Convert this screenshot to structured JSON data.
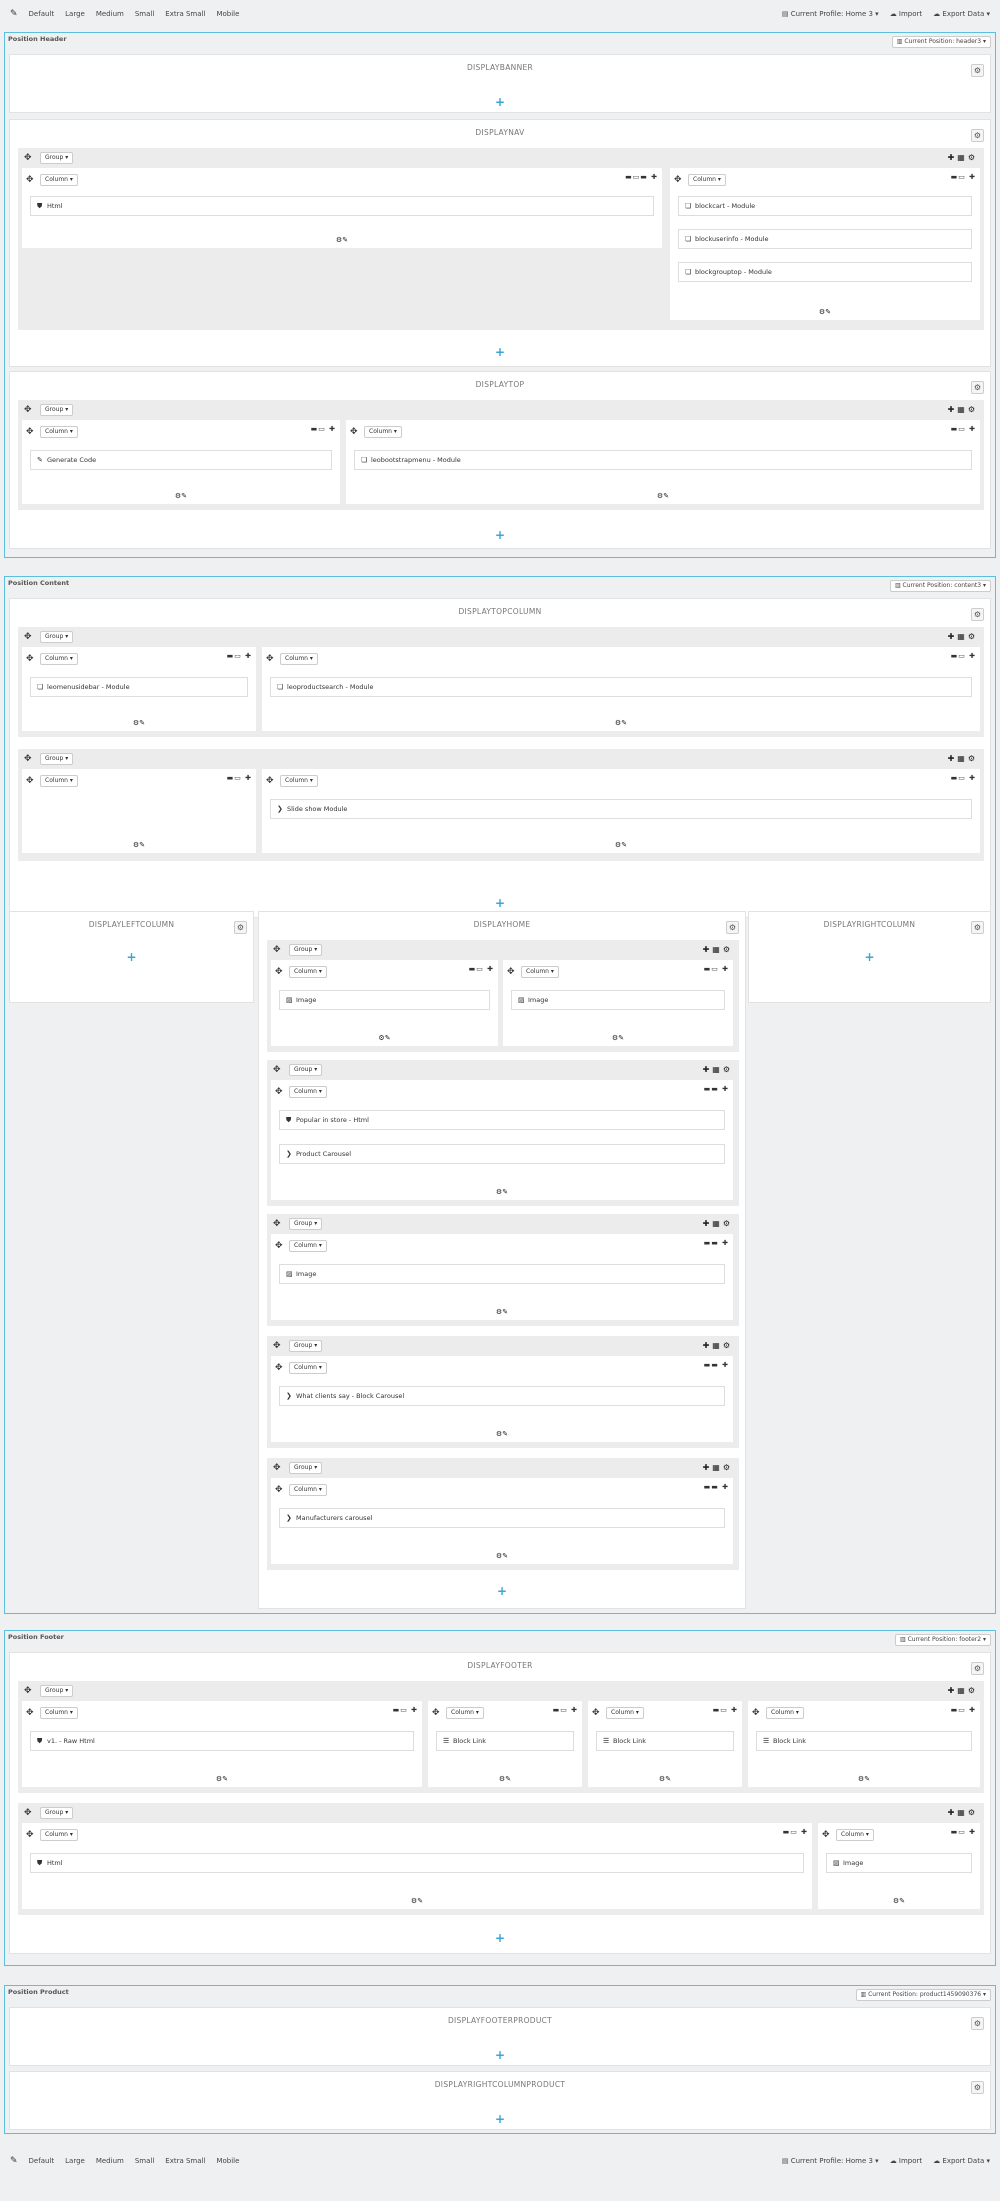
{
  "toolbar": {
    "items": [
      "Default",
      "Large",
      "Medium",
      "Small",
      "Extra Small",
      "Mobile"
    ],
    "profile": "Current Profile: Home 3",
    "import": "Import",
    "export": "Export Data"
  },
  "positions": [
    {
      "title": "Position Header",
      "current": "Current Position: header3"
    },
    {
      "title": "Position Content",
      "current": "Current Position: content3"
    },
    {
      "title": "Position Footer",
      "current": "Current Position: footer2"
    },
    {
      "title": "Position Product",
      "current": "Current Position: product1459090376"
    }
  ],
  "hooks": {
    "displaybanner": "DISPLAYBANNER",
    "displaynav": "DISPLAYNAV",
    "displaytop": "DISPLAYTOP",
    "displaytopcolumn": "DISPLAYTOPCOLUMN",
    "displayleftcolumn": "DISPLAYLEFTCOLUMN",
    "displayhome": "DISPLAYHOME",
    "displayrightcolumn": "DISPLAYRIGHTCOLUMN",
    "displayfooter": "DISPLAYFOOTER",
    "displayfooterproduct": "DISPLAYFOOTERPRODUCT",
    "displayrightcolumnproduct": "DISPLAYRIGHTCOLUMNPRODUCT"
  },
  "labels": {
    "group": "Group",
    "column": "Column"
  },
  "widgets": {
    "nav_html": "Html",
    "nav_blockcart": "blockcart - Module",
    "nav_blockuserinfo": "blockuserinfo - Module",
    "nav_blockgrouptop": "blockgrouptop - Module",
    "top_generate": "Generate Code",
    "top_bootstrapmenu": "leobootstrapmenu - Module",
    "tc_sidebar": "leomenusidebar - Module",
    "tc_search": "leoproductsearch - Module",
    "tc_slideshow": "Slide show Module",
    "home_image1": "Image",
    "home_image2": "Image",
    "home_popular": "Popular in store - Html",
    "home_carousel": "Product Carousel",
    "home_image3": "Image",
    "home_clients": "What clients say - Block Carousel",
    "home_manufacturers": "Manufacturers carousel",
    "foot_raw": "v1. - Raw Html",
    "foot_link1": "Block Link",
    "foot_link2": "Block Link",
    "foot_link3": "Block Link",
    "foot_html": "Html",
    "foot_image": "Image"
  }
}
